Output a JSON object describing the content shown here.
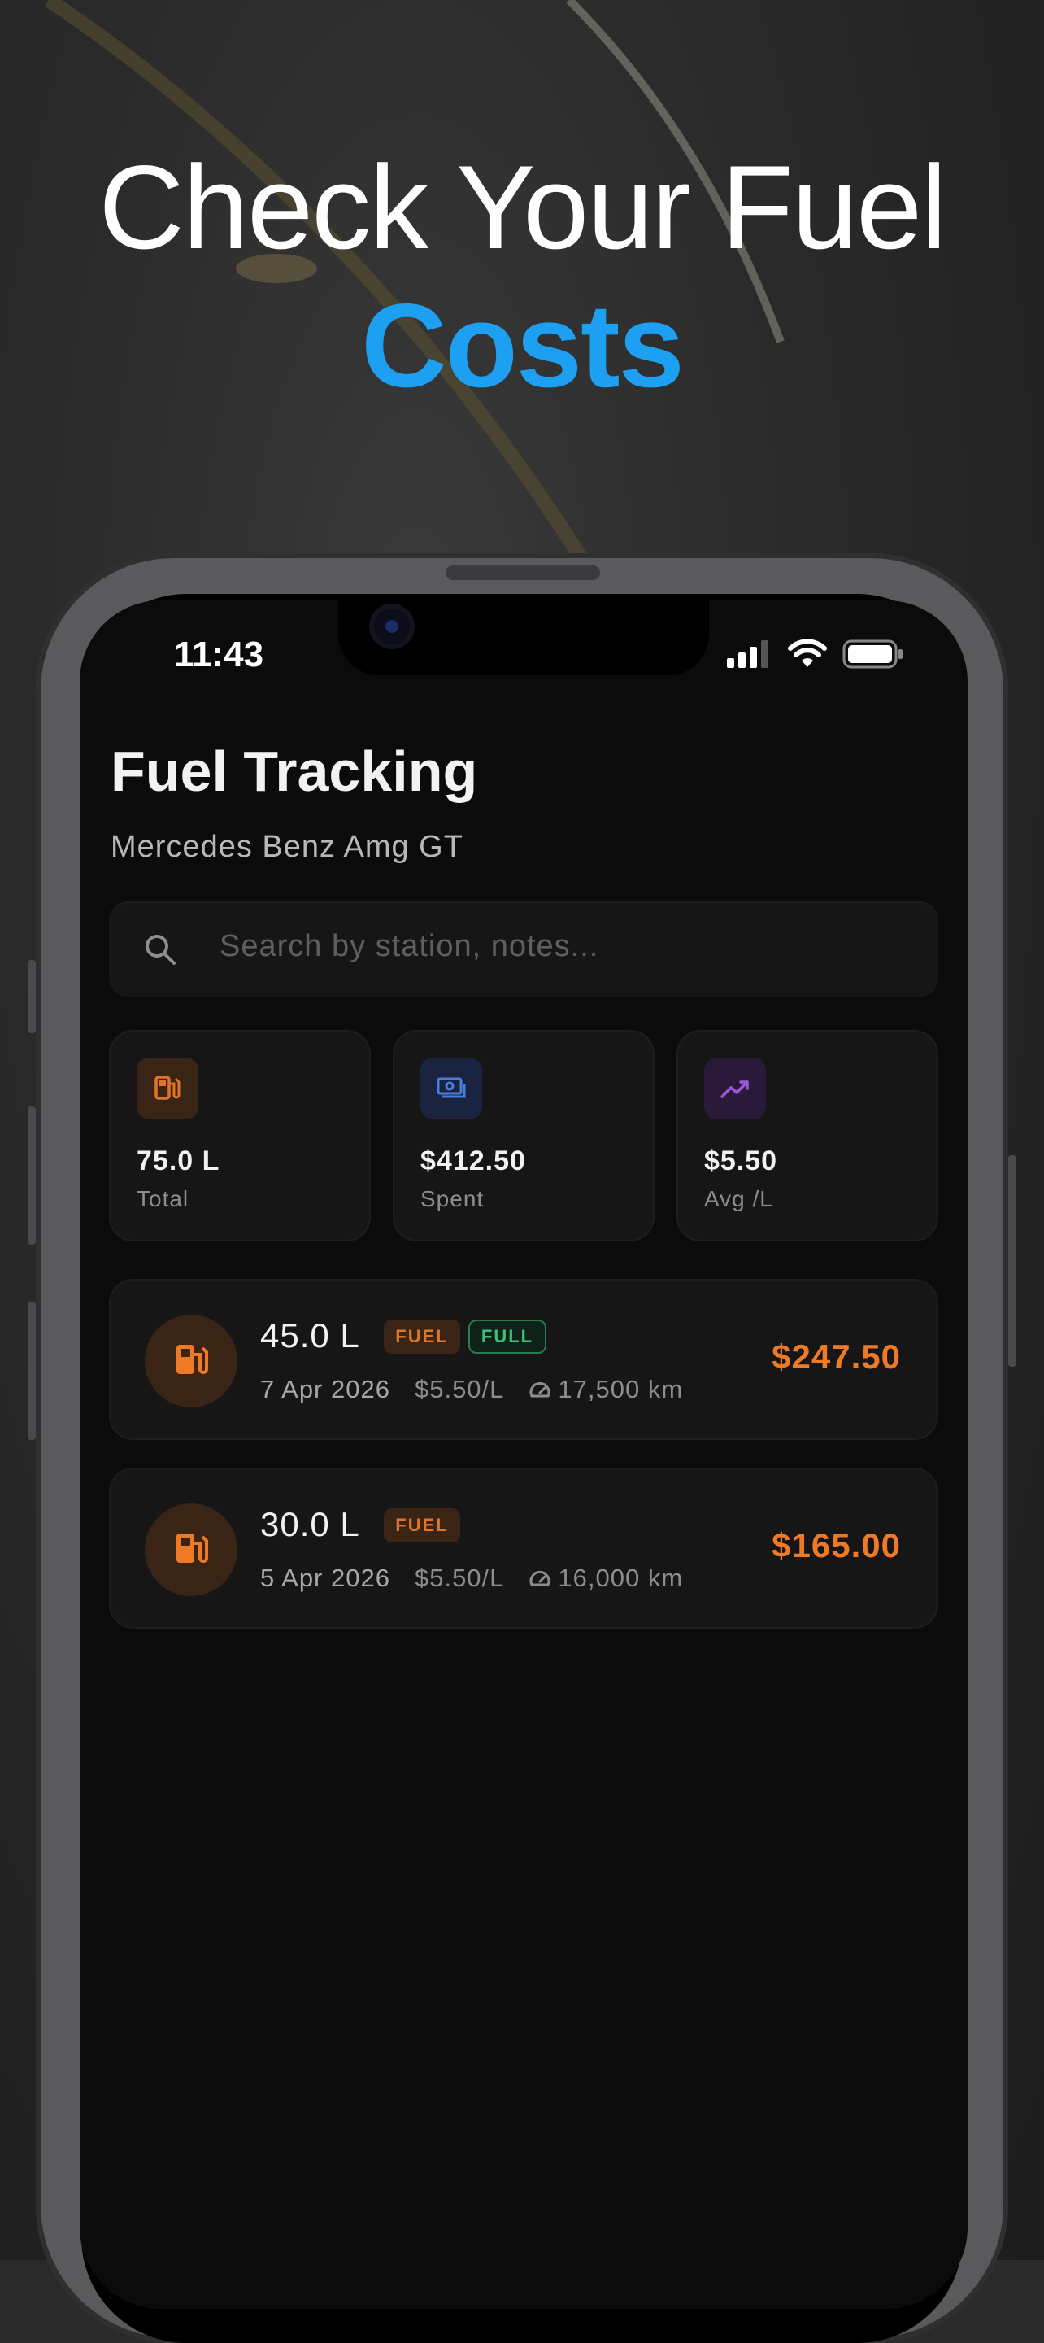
{
  "headline": {
    "line1": "Check Your Fuel",
    "line2": "Costs"
  },
  "status_bar": {
    "time": "11:43"
  },
  "header": {
    "title": "Fuel Tracking",
    "subtitle": "Mercedes Benz Amg GT"
  },
  "search": {
    "placeholder": "Search by station, notes..."
  },
  "stats": [
    {
      "value": "75.0 L",
      "label": "Total",
      "icon": "fuel-pump-icon",
      "color": "#e07428",
      "bg": "#3a2416"
    },
    {
      "value": "$412.50",
      "label": "Spent",
      "icon": "money-icon",
      "color": "#4a7ed8",
      "bg": "#1a2440"
    },
    {
      "value": "$5.50",
      "label": "Avg /L",
      "icon": "trending-up-icon",
      "color": "#9a5ad8",
      "bg": "#2a1a3a"
    }
  ],
  "entries": [
    {
      "liters": "45.0 L",
      "badges": [
        "FUEL",
        "FULL"
      ],
      "date": "7 Apr 2026",
      "price_per_liter": "$5.50/L",
      "odometer": "17,500 km",
      "amount": "$247.50"
    },
    {
      "liters": "30.0 L",
      "badges": [
        "FUEL"
      ],
      "date": "5 Apr 2026",
      "price_per_liter": "$5.50/L",
      "odometer": "16,000 km",
      "amount": "$165.00"
    }
  ],
  "colors": {
    "accent": "#1ea0f2",
    "amount": "#ef7a26",
    "full_badge": "#3cc07a"
  }
}
